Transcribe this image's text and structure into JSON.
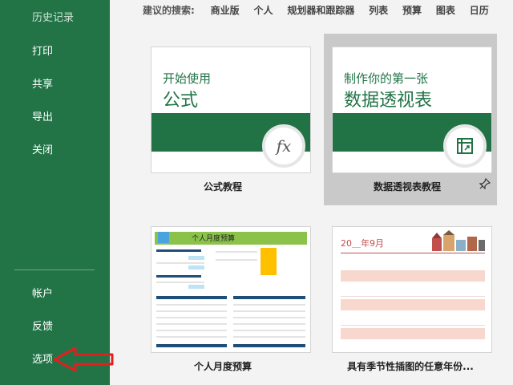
{
  "sidebar": {
    "history": "历史记录",
    "items": [
      "打印",
      "共享",
      "导出",
      "关闭"
    ],
    "bottom_items": [
      "帐户",
      "反馈",
      "选项"
    ]
  },
  "suggestions": {
    "label": "建议的搜索:",
    "links": [
      "商业版",
      "个人",
      "规划器和跟踪器",
      "列表",
      "预算",
      "图表",
      "日历"
    ]
  },
  "templates": [
    {
      "line1": "开始使用",
      "line2": "公式",
      "icon": "fx",
      "label": "公式教程"
    },
    {
      "line1": "制作你的第一张",
      "line2": "数据透视表",
      "icon": "pivot-table-icon",
      "label": "数据透视表教程"
    },
    {
      "title": "个人月度预算",
      "label": "个人月度预算"
    },
    {
      "title": "20＿年9月",
      "label": "具有季节性插图的任意年份..."
    }
  ],
  "colors": {
    "sidebar": "#227447",
    "accent": "#217346",
    "arrow": "#e02020"
  }
}
